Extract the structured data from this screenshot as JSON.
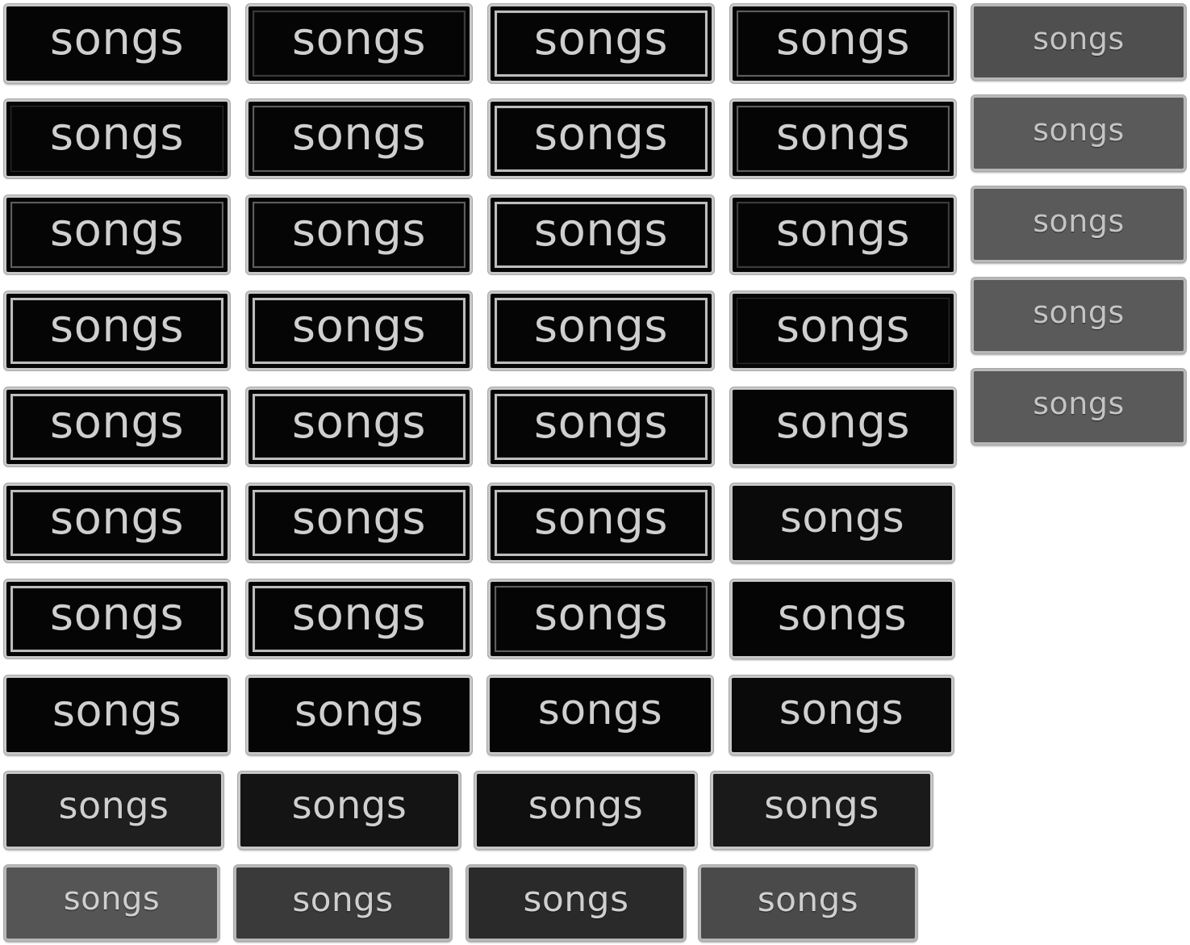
{
  "button_label": "songs",
  "colors": {
    "page_background": "#ffffff",
    "label_text": "#cfcfcf",
    "button_border": "#c8c8c8",
    "dark_fill": "#050505",
    "mid_fill": "#1a1a1a",
    "gray_fill": "#4a4a4a",
    "light_gray_fill": "#5a5a5a"
  },
  "groups": {
    "framed_buttons": "songs",
    "plain_buttons": "songs",
    "small_gray_buttons": "songs"
  },
  "buttons": [
    {
      "label": "songs"
    },
    {
      "label": "songs"
    },
    {
      "label": "songs"
    },
    {
      "label": "songs"
    },
    {
      "label": "songs"
    },
    {
      "label": "songs"
    },
    {
      "label": "songs"
    },
    {
      "label": "songs"
    },
    {
      "label": "songs"
    },
    {
      "label": "songs"
    },
    {
      "label": "songs"
    },
    {
      "label": "songs"
    },
    {
      "label": "songs"
    },
    {
      "label": "songs"
    },
    {
      "label": "songs"
    },
    {
      "label": "songs"
    },
    {
      "label": "songs"
    },
    {
      "label": "songs"
    },
    {
      "label": "songs"
    },
    {
      "label": "songs"
    },
    {
      "label": "songs"
    },
    {
      "label": "songs"
    },
    {
      "label": "songs"
    },
    {
      "label": "songs"
    },
    {
      "label": "songs"
    },
    {
      "label": "songs"
    },
    {
      "label": "songs"
    },
    {
      "label": "songs"
    },
    {
      "label": "songs"
    },
    {
      "label": "songs"
    },
    {
      "label": "songs"
    },
    {
      "label": "songs"
    },
    {
      "label": "songs"
    },
    {
      "label": "songs"
    },
    {
      "label": "songs"
    },
    {
      "label": "songs"
    },
    {
      "label": "songs"
    },
    {
      "label": "songs"
    },
    {
      "label": "songs"
    },
    {
      "label": "songs"
    },
    {
      "label": "songs"
    },
    {
      "label": "songs"
    },
    {
      "label": "songs"
    },
    {
      "label": "songs"
    },
    {
      "label": "songs"
    }
  ]
}
